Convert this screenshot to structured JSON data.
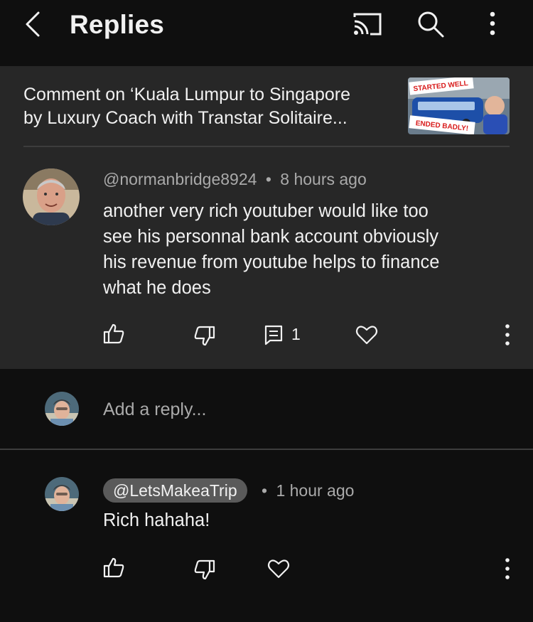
{
  "header": {
    "title": "Replies",
    "back_icon": "chevron-left-icon",
    "cast_icon": "cast-icon",
    "search_icon": "search-icon",
    "more_icon": "more-vertical-icon"
  },
  "context": {
    "line1": "Comment on ‘Kuala Lumpur to Singapore",
    "line2": "by Luxury Coach with Transtar Solitaire...",
    "thumbnail": {
      "top_text": "STARTED WELL",
      "bottom_text": "ENDED BADLY!"
    }
  },
  "comment": {
    "author": "@normanbridge8924",
    "separator": "•",
    "time": "8 hours ago",
    "text_lines": [
      "another very rich youtuber  would like too",
      "see his personnal bank account obviously",
      "his revenue from youtube helps to finance",
      "what he does"
    ],
    "reply_count": "1"
  },
  "reply_box": {
    "placeholder": "Add a reply..."
  },
  "reply": {
    "author": "@LetsMakeaTrip",
    "separator": "•",
    "time": "1 hour ago",
    "text": "Rich hahaha!"
  },
  "colors": {
    "background": "#0f0f0f",
    "panel": "#272727",
    "text_primary": "#f1f1f1",
    "text_secondary": "#aaaaaa",
    "chip": "#5a5a5a"
  }
}
